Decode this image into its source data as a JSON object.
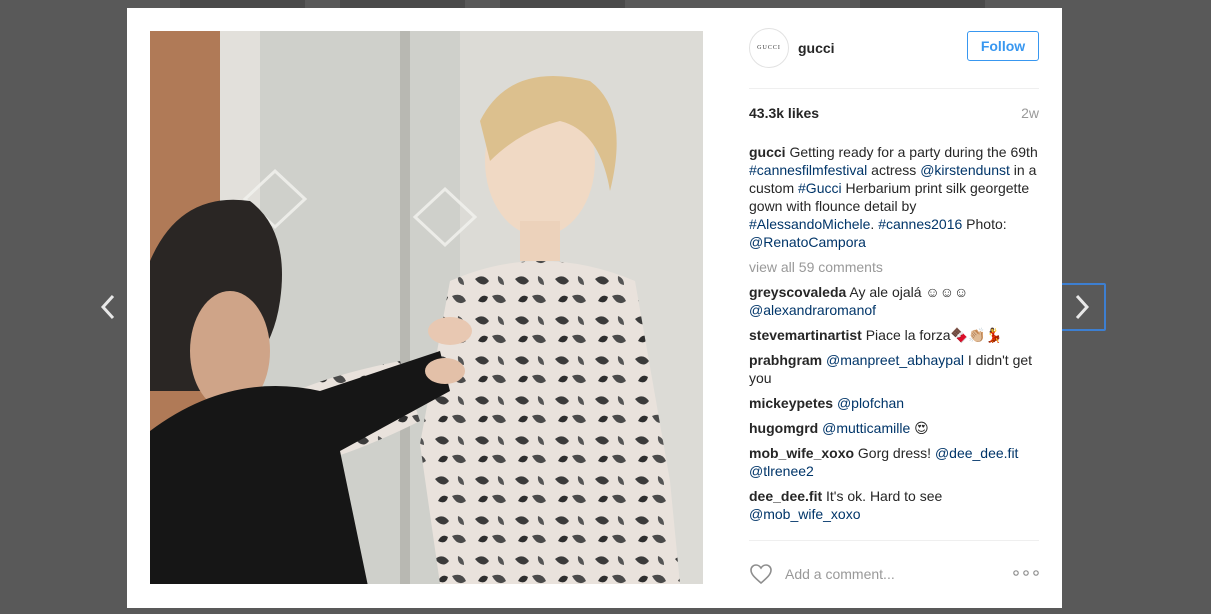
{
  "post": {
    "username": "gucci",
    "avatar_text": "GUCCI",
    "follow_label": "Follow",
    "likes": "43.3k likes",
    "time_ago": "2w",
    "caption": {
      "user": "gucci",
      "parts": [
        {
          "text": " Getting ready for a party during the 69th ",
          "link": false
        },
        {
          "text": "#cannesfilmfestival",
          "link": true
        },
        {
          "text": " actress ",
          "link": false
        },
        {
          "text": "@kirstendunst",
          "link": true
        },
        {
          "text": " in a custom ",
          "link": false
        },
        {
          "text": "#Gucci",
          "link": true
        },
        {
          "text": " Herbarium print silk georgette gown with flounce detail by ",
          "link": false
        },
        {
          "text": "#AlessandoMichele",
          "link": true
        },
        {
          "text": ". ",
          "link": false
        },
        {
          "text": "#cannes2016",
          "link": true
        },
        {
          "text": " Photo: ",
          "link": false
        },
        {
          "text": "@RenatoCampora",
          "link": true
        }
      ]
    },
    "view_all_comments": "view all 59 comments",
    "comments": [
      {
        "user": "greyscovaleda",
        "parts": [
          {
            "text": " Ay ale ojalá ☺☺☺ ",
            "link": false
          },
          {
            "text": "@alexandraromanof",
            "link": true
          }
        ]
      },
      {
        "user": "stevemartinartist",
        "parts": [
          {
            "text": " Piace la forza🍫👏🏼💃",
            "link": false
          }
        ]
      },
      {
        "user": "prabhgram",
        "parts": [
          {
            "text": " ",
            "link": false
          },
          {
            "text": "@manpreet_abhaypal",
            "link": true
          },
          {
            "text": " I didn't get you",
            "link": false
          }
        ]
      },
      {
        "user": "mickeypetes",
        "parts": [
          {
            "text": " ",
            "link": false
          },
          {
            "text": "@plofchan",
            "link": true
          }
        ]
      },
      {
        "user": "hugomgrd",
        "parts": [
          {
            "text": " ",
            "link": false
          },
          {
            "text": "@mutticamille",
            "link": true
          },
          {
            "text": " 😍",
            "link": false
          }
        ]
      },
      {
        "user": "mob_wife_xoxo",
        "parts": [
          {
            "text": " Gorg dress! ",
            "link": false
          },
          {
            "text": "@dee_dee.fit",
            "link": true
          },
          {
            "text": " ",
            "link": false
          },
          {
            "text": "@tlrenee2",
            "link": true
          }
        ]
      },
      {
        "user": "dee_dee.fit",
        "parts": [
          {
            "text": " It's ok. Hard to see ",
            "link": false
          },
          {
            "text": "@mob_wife_xoxo",
            "link": true
          }
        ]
      }
    ],
    "add_comment_placeholder": "Add a comment...",
    "icons": {
      "prev": "chevron-left-icon",
      "next": "chevron-right-icon",
      "like": "heart-icon",
      "more": "more-icon"
    },
    "colors": {
      "link": "#003569",
      "follow": "#3897f0",
      "muted": "#999999"
    }
  }
}
